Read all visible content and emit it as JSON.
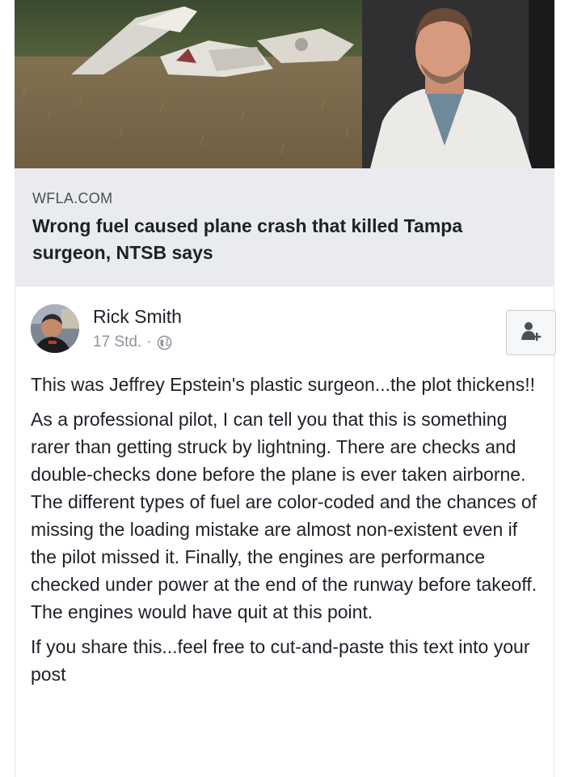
{
  "link": {
    "domain": "WFLA.COM",
    "headline": "Wrong fuel caused plane crash that killed Tampa surgeon, NTSB says"
  },
  "post": {
    "author": "Rick Smith",
    "time": "17 Std.",
    "separator": "·",
    "privacy_icon": "globe-icon",
    "action_icon": "add-friend-icon",
    "paragraphs": [
      "This was Jeffrey Epstein's plastic surgeon...the plot thickens!!",
      "As a professional pilot, I can tell you that this is something rarer than getting struck by lightning. There are checks and double-checks done before the plane is ever taken airborne. The different types of fuel are color-coded and the chances of missing the loading mistake are almost non-existent even if the pilot missed it. Finally, the engines are performance checked under power at the end of the runway before takeoff. The engines would have quit at this point.",
      "If you share this...feel free to cut-and-paste this text into your post"
    ]
  },
  "colors": {
    "preview_bg": "#e9ebee",
    "text": "#1d2129",
    "muted": "#90949c"
  }
}
